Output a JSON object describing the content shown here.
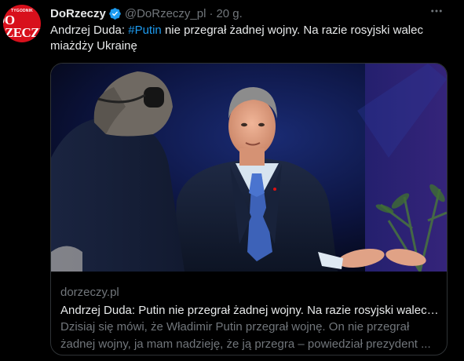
{
  "author": {
    "avatar_small_text": "TYGODNIK",
    "avatar_text": "DO RZECZY",
    "display_name": "DoRzeczy",
    "handle": "@DoRzeczy_pl",
    "separator": "·",
    "time": "20 g."
  },
  "tweet": {
    "text_before": "Andrzej Duda: ",
    "hashtag": "#Putin",
    "text_after": " nie przegrał żadnej wojny. Na razie rosyjski walec miażdży Ukrainę"
  },
  "card": {
    "domain": "dorzeczy.pl",
    "title": "Andrzej Duda: Putin nie przegrał żadnej wojny. Na razie rosyjski walec miażdży Ukrainę",
    "description": "Dzisiaj się mówi, że Władimir Putin przegrał wojnę. On nie przegrał żadnej wojny, ja mam nadzieję, że ją przegra – powiedział prezydent ..."
  },
  "icons": {
    "verified": "verified-badge-icon",
    "more": "more-options-icon"
  },
  "colors": {
    "background": "#000000",
    "text_primary": "#e7e9ea",
    "text_secondary": "#71767b",
    "accent": "#1d9bf0",
    "avatar_brand": "#d8101c",
    "border": "#2f3336"
  }
}
